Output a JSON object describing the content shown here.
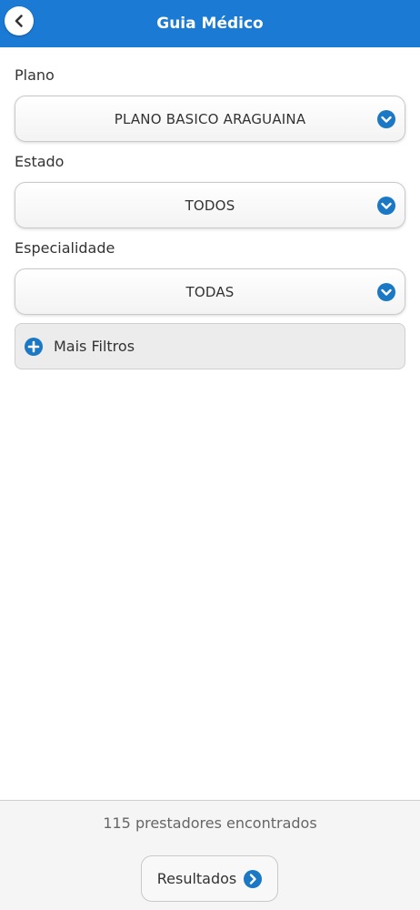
{
  "header": {
    "title": "Guia Médico",
    "back_icon": "chevron-left-icon"
  },
  "form": {
    "plano": {
      "label": "Plano",
      "value": "PLANO BASICO ARAGUAINA"
    },
    "estado": {
      "label": "Estado",
      "value": "TODOS"
    },
    "especialidade": {
      "label": "Especialidade",
      "value": "TODAS"
    },
    "mais_filtros": {
      "label": "Mais Filtros",
      "icon": "plus-circle-icon"
    }
  },
  "footer": {
    "count_text": "115 prestadores encontrados",
    "results_label": "Resultados",
    "results_icon": "chevron-right-circle-icon"
  },
  "colors": {
    "primary": "#1a7ad4",
    "icon_blue": "#1b78c4"
  }
}
